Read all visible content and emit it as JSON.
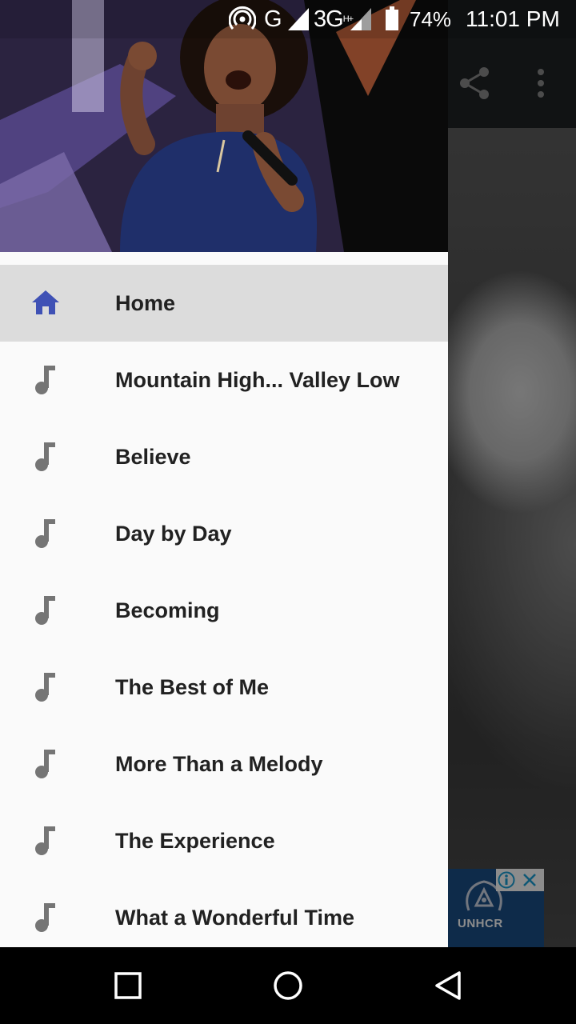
{
  "status_bar": {
    "network_g": "G",
    "network_3g": "3G",
    "network_3g_sup": "H+",
    "battery": "74%",
    "time": "11:01 PM",
    "icons": [
      "hotspot-icon",
      "signal-icon",
      "signal-icon",
      "battery-icon"
    ]
  },
  "toolbar": {
    "icons": [
      "share-icon",
      "more-vert-icon"
    ]
  },
  "drawer": {
    "header_image": "singer-photo",
    "items": [
      {
        "label": "Home",
        "icon": "home-icon",
        "selected": true
      },
      {
        "label": "Mountain High... Valley Low",
        "icon": "music-note-icon"
      },
      {
        "label": "Believe",
        "icon": "music-note-icon"
      },
      {
        "label": "Day by Day",
        "icon": "music-note-icon"
      },
      {
        "label": "Becoming",
        "icon": "music-note-icon"
      },
      {
        "label": "The Best of Me",
        "icon": "music-note-icon"
      },
      {
        "label": "More Than a Melody",
        "icon": "music-note-icon"
      },
      {
        "label": "The Experience",
        "icon": "music-note-icon"
      },
      {
        "label": "What a Wonderful Time",
        "icon": "music-note-icon"
      }
    ]
  },
  "ad": {
    "brand": "UNHCR",
    "icons": [
      "info-icon",
      "close-icon"
    ]
  },
  "nav_bar": {
    "icons": [
      "recent-apps-icon",
      "home-circle-icon",
      "back-icon"
    ]
  },
  "colors": {
    "accent": "#3f51b5",
    "icon_gray": "#757575",
    "selected_bg": "#dcdcdc",
    "drawer_bg": "#fafafa",
    "text": "#212121",
    "ad_bg": "#1b4f87"
  }
}
